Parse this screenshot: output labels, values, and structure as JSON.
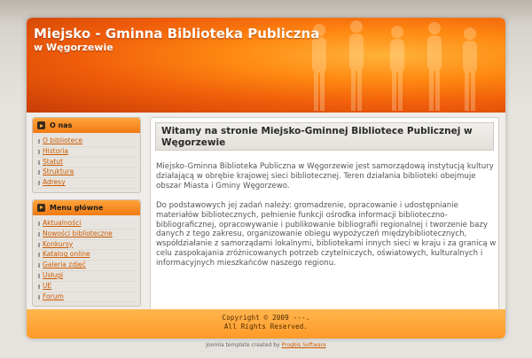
{
  "header": {
    "title": "Miejsko - Gminna Biblioteka Publiczna",
    "subtitle": "w Węgorzewie"
  },
  "sidebar": {
    "about": {
      "heading": "O nas",
      "items": [
        "O bibliotece",
        "Historia",
        "Statut",
        "Struktura",
        "Adresy"
      ]
    },
    "main_menu": {
      "heading": "Menu główne",
      "items": [
        "Aktualności",
        "Nowości biblioteczne",
        "Konkursy",
        "Katalog online",
        "Galeria zdjęć",
        "Usługi",
        "UE",
        "Forum"
      ]
    }
  },
  "content": {
    "title": "Witamy na stronie Miejsko-Gminnej Bibliotece Publicznej w Węgorzewie",
    "paragraphs": [
      "Miejsko-Gminna Biblioteka Publiczna w Węgorzewie jest samorządową instytucją kultury działającą w obrębie krajowej sieci bibliotecznej. Teren działania biblioteki obejmuje obszar Miasta i Gminy Węgorzewo.",
      "Do podstawowych jej zadań należy: gromadzenie, opracowanie i udostępnianie materiałów bibliotecznych, pełnienie funkcji ośrodka informacji biblioteczno-bibliograficznej, opracowywanie i publikowanie bibliografii regionalnej i tworzenie bazy danych z tego zakresu, organizowanie obiegu wypożyczeń międzybibliotecznych, współdziałanie z samorządami lokalnymi, bibliotekami innych sieci w kraju i za granicą w celu zaspokajania zróżnicowanych potrzeb czytelniczych, oświatowych, kulturalnych i informacyjnych mieszkańców naszego regionu."
    ]
  },
  "footer": {
    "copyright": "Copyright © 2009 ---.",
    "rights": "All Rights Reserved."
  },
  "credit": {
    "text": "Joomla template created by ",
    "link": "Progbis Software"
  },
  "colors": {
    "accent": "#f27b14",
    "link": "#cc5a00",
    "footer": "#ffa33a"
  }
}
